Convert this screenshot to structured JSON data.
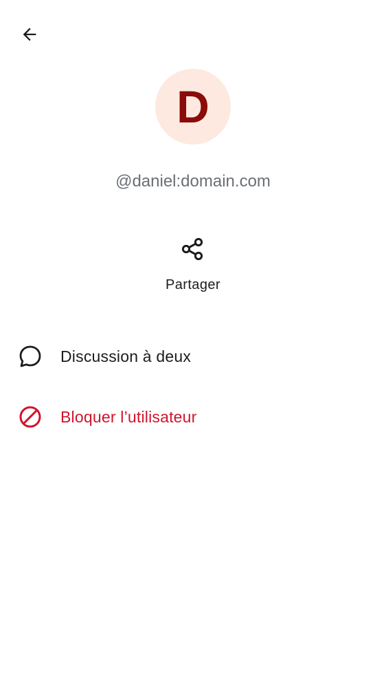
{
  "header": {
    "back_icon": "arrow-back-icon"
  },
  "profile": {
    "avatar_initial": "D",
    "avatar_bg": "#fde9df",
    "avatar_fg": "#8b0a0a",
    "user_id": "@daniel:domain.com"
  },
  "actions": {
    "share": {
      "icon": "share-icon",
      "label": "Partager"
    }
  },
  "menu": {
    "direct_chat": {
      "icon": "chat-bubble-icon",
      "label": "Discussion à deux"
    },
    "block_user": {
      "icon": "block-icon",
      "label": "Bloquer l’utilisateur",
      "color": "#d0142b"
    }
  }
}
